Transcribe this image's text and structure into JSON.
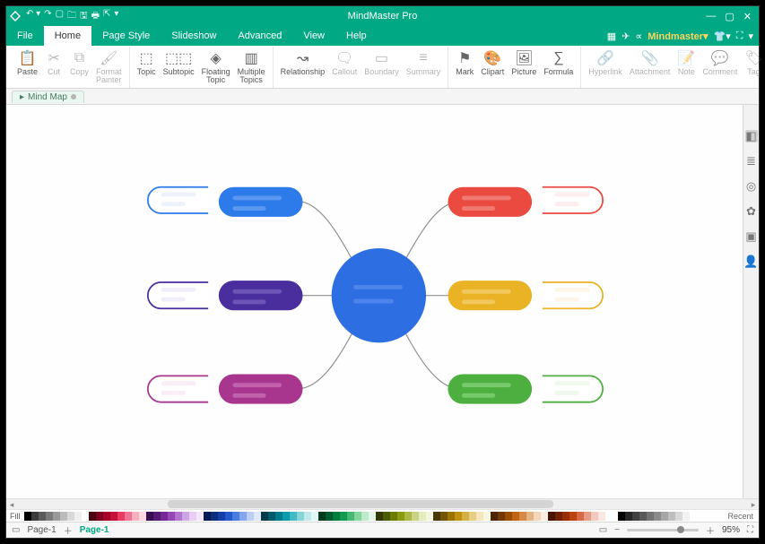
{
  "title": "MindMaster Pro",
  "brand": "Mindmaster",
  "menus": {
    "file": "File",
    "home": "Home",
    "pagestyle": "Page Style",
    "slideshow": "Slideshow",
    "advanced": "Advanced",
    "view": "View",
    "help": "Help"
  },
  "ribbon": {
    "paste": "Paste",
    "cut": "Cut",
    "copy": "Copy",
    "formatpainter": "Format\nPainter",
    "topic": "Topic",
    "subtopic": "Subtopic",
    "floating": "Floating\nTopic",
    "multiple": "Multiple\nTopics",
    "relationship": "Relationship",
    "callout": "Callout",
    "boundary": "Boundary",
    "summary": "Summary",
    "mark": "Mark",
    "clipart": "Clipart",
    "picture": "Picture",
    "formula": "Formula",
    "hyperlink": "Hyperlink",
    "attachment": "Attachment",
    "note": "Note",
    "comment": "Comment",
    "tag": "Tag"
  },
  "doc_tab": "Mind Map",
  "palette_label": "Fill",
  "recent_label": "Recent",
  "status": {
    "page1": "Page-1",
    "page_active": "Page-1",
    "zoom": "95%"
  },
  "palette": [
    "#000000",
    "#3b3b3b",
    "#5b5b5b",
    "#7a7a7a",
    "#9a9a9a",
    "#bcbcbc",
    "#d9d9d9",
    "#efefef",
    "#ffffff",
    "#4b0010",
    "#7d001c",
    "#a4002a",
    "#c51038",
    "#e73b62",
    "#f07394",
    "#f7aebe",
    "#fcd8e1",
    "#3a0d4e",
    "#571a74",
    "#732895",
    "#9447b7",
    "#b274d0",
    "#cfa4e4",
    "#e6cff2",
    "#f3e7f9",
    "#071b53",
    "#0d2d7f",
    "#143fa8",
    "#2558cc",
    "#4a7ce0",
    "#83a6ec",
    "#bccdf6",
    "#e0e9fb",
    "#003b4b",
    "#005b6c",
    "#007b8d",
    "#0d9bab",
    "#41bac3",
    "#84d4d8",
    "#c0eaea",
    "#e3f6f6",
    "#003b1b",
    "#005c2c",
    "#007d3d",
    "#119b4e",
    "#45b973",
    "#84d4a0",
    "#bcebc9",
    "#e2f6e8",
    "#313b00",
    "#4e5c00",
    "#6b7d00",
    "#8a9a11",
    "#aab845",
    "#cad484",
    "#e4ebbc",
    "#f3f7e2",
    "#4b3800",
    "#735500",
    "#9a7300",
    "#bd9211",
    "#d5b145",
    "#e6cf84",
    "#f2e6bc",
    "#faf4e2",
    "#4b2400",
    "#733800",
    "#9a4c00",
    "#bd6511",
    "#d58945",
    "#e6b384",
    "#f2d7bc",
    "#fbeee2",
    "#4b1400",
    "#732100",
    "#9a2e00",
    "#bd4211",
    "#d56b45",
    "#e69c84",
    "#f2c9bc",
    "#fbe7e2"
  ],
  "bw": [
    "#000000",
    "#262626",
    "#404040",
    "#595959",
    "#737373",
    "#8c8c8c",
    "#a6a6a6",
    "#bfbfbf",
    "#d9d9d9",
    "#f2f2f2",
    "#ffffff"
  ]
}
